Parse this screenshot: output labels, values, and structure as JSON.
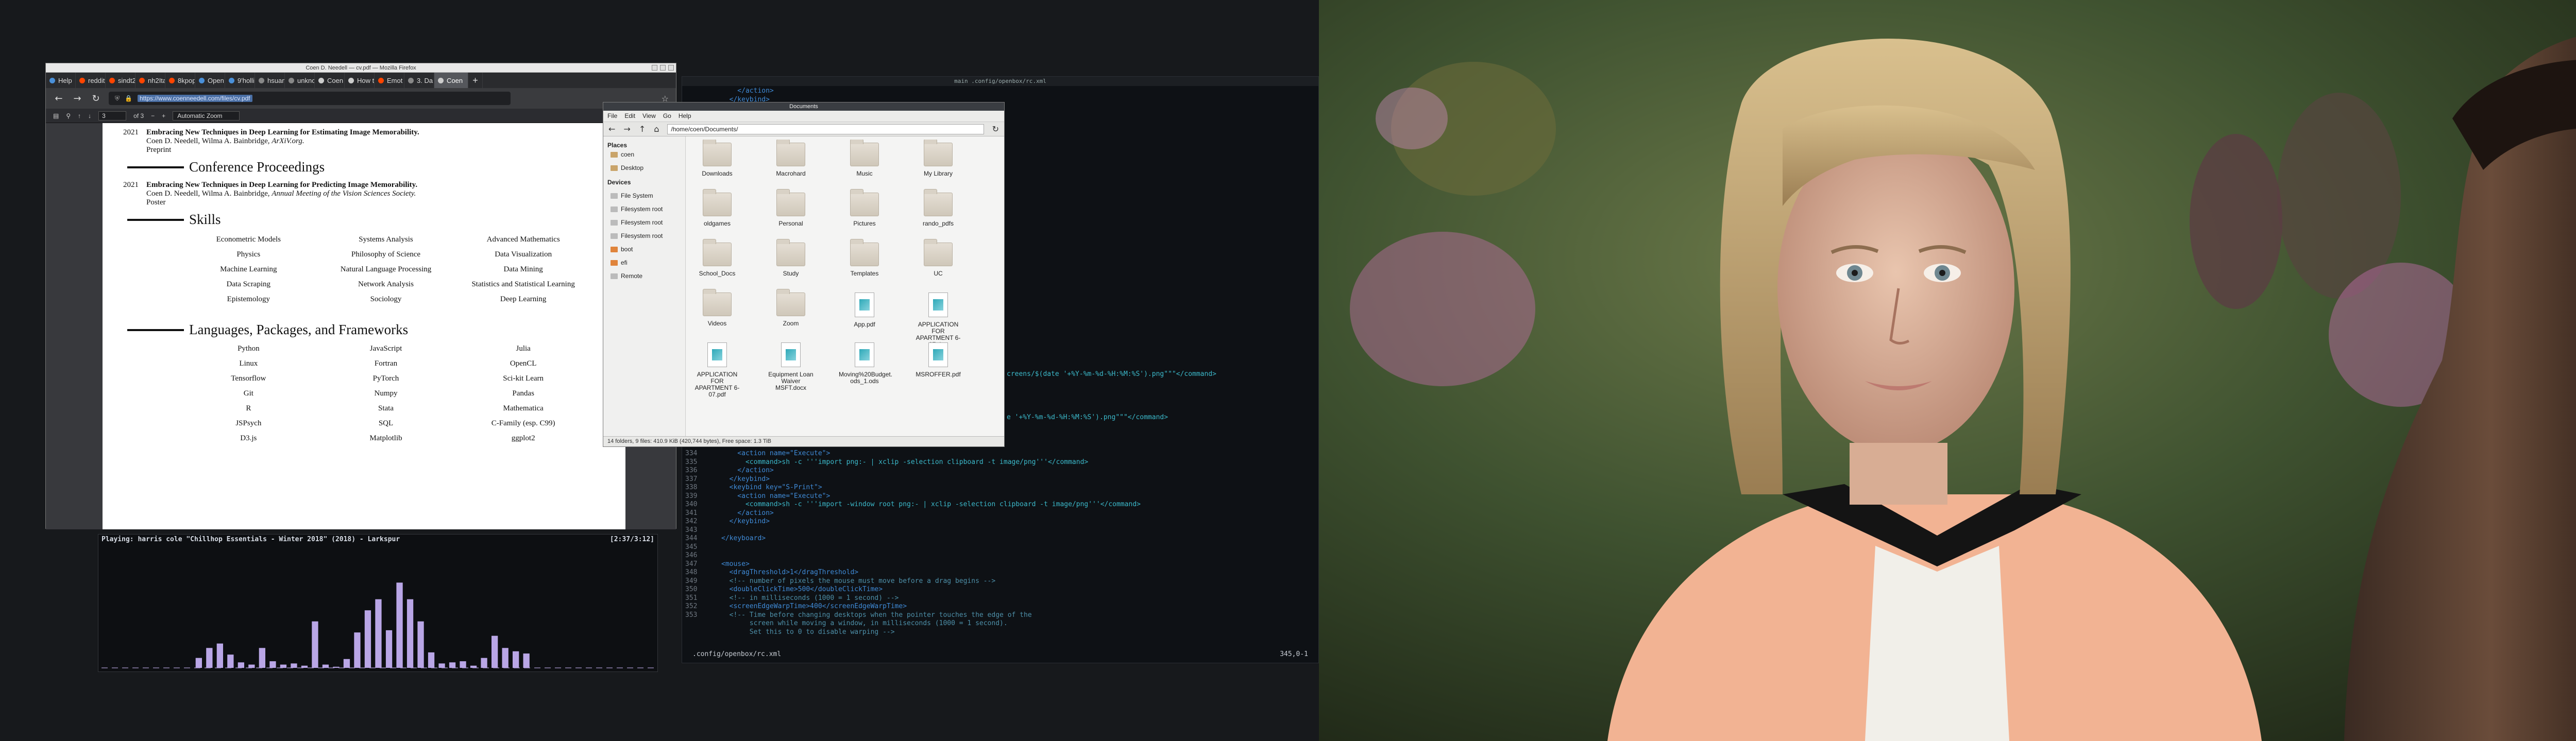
{
  "firefox": {
    "window_title": "Coen D. Needell — cv.pdf — Mozilla Firefox",
    "tabs": [
      {
        "label": "Help",
        "color": "#4a90d9"
      },
      {
        "label": "reddit",
        "color": "#ff4500"
      },
      {
        "label": "sindt20",
        "color": "#ff4500"
      },
      {
        "label": "nh2Ital",
        "color": "#ff4500"
      },
      {
        "label": "8kpopfo",
        "color": "#ff4500"
      },
      {
        "label": "Open",
        "color": "#4a90d9"
      },
      {
        "label": "9'hollim",
        "color": "#4a90d9"
      },
      {
        "label": "hsuan7m",
        "color": "#888888"
      },
      {
        "label": "unknow",
        "color": "#888888"
      },
      {
        "label": "Coen D.",
        "color": "#cccccc"
      },
      {
        "label": "How to",
        "color": "#cccccc"
      },
      {
        "label": "Emot",
        "color": "#ff4500"
      },
      {
        "label": "3. Da",
        "color": "#888888"
      },
      {
        "label": "Coen",
        "color": "#cccccc"
      }
    ],
    "new_tab": "+",
    "url": "https://www.coenneedell.com/files/cv.pdf",
    "pdf_toolbar": {
      "page_value": "3",
      "page_total": "of 3",
      "zoom": "Automatic Zoom",
      "zoom_out": "−",
      "zoom_in": "+"
    },
    "pdf": {
      "pub1": {
        "year": "2021",
        "title": "Embracing New Techniques in Deep Learning for Estimating Image Memorability.",
        "authors": "Coen D. Needell, Wilma A. Bainbridge, ",
        "venue": "ArXiV.org.",
        "status": "Preprint"
      },
      "sec_conf": "Conference Proceedings",
      "pub2": {
        "year": "2021",
        "title": "Embracing New Techniques in Deep Learning for Predicting Image Memorability.",
        "authors": "Coen D. Needell, Wilma A. Bainbridge, ",
        "venue": "Annual Meeting of the Vision Sciences Society.",
        "status": "Poster"
      },
      "sec_skills": "Skills",
      "skills": [
        "Econometric Models",
        "Systems Analysis",
        "Advanced Mathematics",
        "Physics",
        "Philosophy of Science",
        "Data Visualization",
        "Machine Learning",
        "Natural Language Processing",
        "Data Mining",
        "Data Scraping",
        "Network Analysis",
        "Statistics and Statistical Learning",
        "Epistemology",
        "Sociology",
        "Deep Learning"
      ],
      "sec_lang": "Languages, Packages, and Frameworks",
      "langs": [
        "Python",
        "JavaScript",
        "Julia",
        "Linux",
        "Fortran",
        "OpenCL",
        "Tensorflow",
        "PyTorch",
        "Sci-kit Learn",
        "Git",
        "Numpy",
        "Pandas",
        "R",
        "Stata",
        "Mathematica",
        "JSPsych",
        "SQL",
        "C-Family (esp. C99)",
        "D3.js",
        "Matplotlib",
        "ggplot2"
      ]
    }
  },
  "player": {
    "now_playing": "Playing: harris cole \"Chillhop Essentials - Winter 2018\" (2018) - Larkspur",
    "time": "[2:37/3:12]",
    "bar_levels": [
      0,
      0,
      0,
      0,
      0,
      0,
      0,
      0,
      0,
      0.09,
      0.18,
      0.22,
      0.12,
      0.05,
      0.03,
      0.18,
      0.06,
      0.03,
      0.04,
      0.02,
      0.42,
      0.03,
      0.01,
      0.08,
      0.32,
      0.52,
      0.62,
      0.34,
      0.77,
      0.62,
      0.42,
      0.14,
      0.04,
      0.05,
      0.06,
      0.02,
      0.09,
      0.29,
      0.18,
      0.15,
      0.13,
      0,
      0,
      0,
      0,
      0,
      0,
      0,
      0,
      0,
      0,
      0,
      0
    ]
  },
  "editor": {
    "title": "main  .config/openbox/rc.xml",
    "filename": ".config/openbox/rc.xml",
    "position": "345,0-1",
    "lines_top": [
      {
        "n": "",
        "t": "    </action>",
        "k": "tag"
      },
      {
        "n": "",
        "t": "  </keybind>",
        "k": "tag"
      }
    ],
    "line_mid1": {
      "t": "creens/$(date '+%Y-%m-%d-%H:%M:%S').png\"\"\"</command>",
      "k": "str"
    },
    "line_mid2": {
      "t": "e '+%Y-%m-%d-%H:%M:%S').png\"\"\"</command>",
      "k": "str"
    },
    "lines_bottom": [
      {
        "n": "334",
        "t": "    <action name=\"Execute\">",
        "k": "tag"
      },
      {
        "n": "335",
        "t": "      <command>sh -c '''import png:- | xclip -selection clipboard -t image/png'''</command>",
        "k": "str"
      },
      {
        "n": "336",
        "t": "    </action>",
        "k": "tag"
      },
      {
        "n": "337",
        "t": "  </keybind>",
        "k": "tag"
      },
      {
        "n": "338",
        "t": "  <keybind key=\"S-Print\">",
        "k": "tag"
      },
      {
        "n": "339",
        "t": "    <action name=\"Execute\">",
        "k": "tag"
      },
      {
        "n": "340",
        "t": "      <command>sh -c '''import -window root png:- | xclip -selection clipboard -t image/png'''</command>",
        "k": "str"
      },
      {
        "n": "341",
        "t": "    </action>",
        "k": "tag"
      },
      {
        "n": "342",
        "t": "  </keybind>",
        "k": "tag"
      },
      {
        "n": "343",
        "t": "",
        "k": "plain"
      },
      {
        "n": "344",
        "t": "</keyboard>",
        "k": "tag"
      },
      {
        "n": "345",
        "t": "",
        "k": "plain"
      },
      {
        "n": "346",
        "t": "",
        "k": "plain"
      },
      {
        "n": "347",
        "t": "<mouse>",
        "k": "tag"
      },
      {
        "n": "348",
        "t": "  <dragThreshold>1</dragThreshold>",
        "k": "tag"
      },
      {
        "n": "349",
        "t": "  <!-- number of pixels the mouse must move before a drag begins -->",
        "k": "com"
      },
      {
        "n": "350",
        "t": "  <doubleClickTime>500</doubleClickTime>",
        "k": "tag"
      },
      {
        "n": "351",
        "t": "  <!-- in milliseconds (1000 = 1 second) -->",
        "k": "com"
      },
      {
        "n": "352",
        "t": "  <screenEdgeWarpTime>400</screenEdgeWarpTime>",
        "k": "tag"
      },
      {
        "n": "353",
        "t": "  <!-- Time before changing desktops when the pointer touches the edge of the",
        "k": "com"
      },
      {
        "n": "",
        "t": "       screen while moving a window, in milliseconds (1000 = 1 second).",
        "k": "com"
      },
      {
        "n": "",
        "t": "       Set this to 0 to disable warping -->",
        "k": "com"
      }
    ]
  },
  "filemanager": {
    "title": "Documents",
    "menu": [
      "File",
      "Edit",
      "View",
      "Go",
      "Help"
    ],
    "path": "/home/coen/Documents/",
    "places_heading": "Places",
    "places": [
      "coen",
      "Desktop"
    ],
    "devices_heading": "Devices",
    "devices": [
      "File System",
      "Filesystem root",
      "Filesystem root",
      "Filesystem root",
      "boot",
      "efi",
      "Remote"
    ],
    "items": [
      {
        "label": "Downloads",
        "kind": "folder"
      },
      {
        "label": "Macrohard",
        "kind": "folder"
      },
      {
        "label": "Music",
        "kind": "folder"
      },
      {
        "label": "My Library",
        "kind": "folder"
      },
      {
        "label": "oldgames",
        "kind": "folder"
      },
      {
        "label": "Personal",
        "kind": "folder"
      },
      {
        "label": "Pictures",
        "kind": "folder"
      },
      {
        "label": "rando_pdfs",
        "kind": "folder"
      },
      {
        "label": "School_Docs",
        "kind": "folder"
      },
      {
        "label": "Study",
        "kind": "folder"
      },
      {
        "label": "Templates",
        "kind": "folder"
      },
      {
        "label": "UC",
        "kind": "folder"
      },
      {
        "label": "Videos",
        "kind": "folder"
      },
      {
        "label": "Zoom",
        "kind": "folder"
      },
      {
        "label": "App.pdf",
        "kind": "file"
      },
      {
        "label": "APPLICATION FOR APARTMENT 6-07.doc",
        "kind": "file"
      },
      {
        "label": "APPLICATION FOR APARTMENT 6-07.pdf",
        "kind": "file"
      },
      {
        "label": "Equipment Loan Waiver MSFT.docx",
        "kind": "file"
      },
      {
        "label": "Moving%20Budget. ods_1.ods",
        "kind": "file"
      },
      {
        "label": "MSROFFER.pdf",
        "kind": "file"
      }
    ],
    "status": "14 folders, 9 files: 410.9 KiB (420,744 bytes), Free space: 1.3 TiB"
  },
  "colors": {
    "terminal_bg": "#0e1115",
    "tag": "#3f8ad6",
    "string": "#3bb8c9",
    "comment": "#4d8fa8",
    "viz_bar": "#b9a6e6"
  }
}
